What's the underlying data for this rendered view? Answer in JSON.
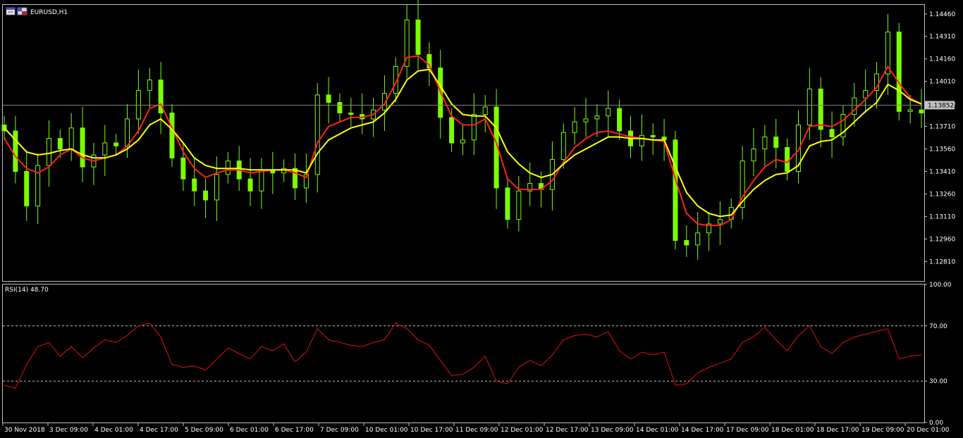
{
  "window": {
    "symbol_title": "EURUSD,H1",
    "icons": [
      "chart-window-icon",
      "symbol-flag-icon"
    ]
  },
  "colors": {
    "background": "#000000",
    "axis": "#c0c0c0",
    "candle": "#7CFC00",
    "ma_fast": "#ff2020",
    "ma_slow": "#ffff00",
    "rsi_line": "#e01010",
    "current_price_box": "#c0c0c0"
  },
  "chart_data": [
    {
      "type": "candlestick",
      "title": "EURUSD,H1",
      "ylim": [
        1.1268,
        1.1452
      ],
      "y_ticks": [
        "1.14460",
        "1.14310",
        "1.14160",
        "1.14010",
        "1.13860",
        "1.13710",
        "1.13560",
        "1.13410",
        "1.13260",
        "1.13110",
        "1.12960",
        "1.12810"
      ],
      "current_price": "1.13852",
      "x_ticks": [
        "30 Nov 2018",
        "3 Dec 09:00",
        "4 Dec 01:00",
        "4 Dec 17:00",
        "5 Dec 09:00",
        "6 Dec 01:00",
        "6 Dec 17:00",
        "7 Dec 09:00",
        "10 Dec 01:00",
        "10 Dec 17:00",
        "11 Dec 09:00",
        "12 Dec 01:00",
        "12 Dec 17:00",
        "13 Dec 09:00",
        "14 Dec 01:00",
        "14 Dec 17:00",
        "17 Dec 09:00",
        "18 Dec 01:00",
        "18 Dec 17:00",
        "19 Dec 09:00",
        "20 Dec 01:00"
      ],
      "series": [
        {
          "kind": "close",
          "values": [
            1.1368,
            1.1341,
            1.1318,
            1.1345,
            1.1363,
            1.1356,
            1.137,
            1.1344,
            1.1352,
            1.136,
            1.1358,
            1.1376,
            1.1395,
            1.1402,
            1.138,
            1.135,
            1.1336,
            1.1328,
            1.1322,
            1.1339,
            1.1348,
            1.1336,
            1.1328,
            1.1342,
            1.134,
            1.1343,
            1.133,
            1.1339,
            1.1392,
            1.1387,
            1.138,
            1.1379,
            1.1376,
            1.1382,
            1.1393,
            1.1411,
            1.1442,
            1.1419,
            1.141,
            1.1377,
            1.136,
            1.1362,
            1.1379,
            1.1384,
            1.133,
            1.1309,
            1.1328,
            1.1333,
            1.1329,
            1.1349,
            1.1367,
            1.1374,
            1.1376,
            1.1378,
            1.1383,
            1.1368,
            1.1358,
            1.1365,
            1.1364,
            1.1362,
            1.1295,
            1.1292,
            1.13,
            1.1306,
            1.1309,
            1.1317,
            1.1348,
            1.1356,
            1.1364,
            1.1357,
            1.1341,
            1.1372,
            1.1396,
            1.1369,
            1.1364,
            1.1379,
            1.139,
            1.1395,
            1.1406,
            1.1434,
            1.1381,
            1.1382,
            1.138
          ]
        },
        {
          "name": "",
          "kind": "ma_fast",
          "values": [
            1.1363,
            1.1351,
            1.1343,
            1.134,
            1.1344,
            1.1352,
            1.1356,
            1.135,
            1.1348,
            1.135,
            1.1352,
            1.1358,
            1.1368,
            1.1383,
            1.1386,
            1.137,
            1.1354,
            1.1343,
            1.1337,
            1.134,
            1.1342,
            1.1342,
            1.134,
            1.1341,
            1.1342,
            1.1342,
            1.134,
            1.1337,
            1.136,
            1.1371,
            1.1374,
            1.1377,
            1.1377,
            1.1379,
            1.1386,
            1.14,
            1.1417,
            1.1418,
            1.1412,
            1.1394,
            1.1378,
            1.1372,
            1.1372,
            1.1376,
            1.136,
            1.1336,
            1.1329,
            1.1329,
            1.1329,
            1.1335,
            1.1347,
            1.1357,
            1.1363,
            1.1367,
            1.1368,
            1.1366,
            1.1364,
            1.1363,
            1.1362,
            1.1361,
            1.1336,
            1.1313,
            1.1306,
            1.1305,
            1.1305,
            1.1309,
            1.1324,
            1.1335,
            1.1344,
            1.1349,
            1.1347,
            1.1355,
            1.1371,
            1.1372,
            1.1371,
            1.1375,
            1.1382,
            1.1389,
            1.1397,
            1.1411,
            1.14,
            1.139,
            1.1386
          ]
        },
        {
          "name": "",
          "kind": "ma_slow",
          "values": [
            1.137,
            1.1362,
            1.1354,
            1.1352,
            1.1353,
            1.1355,
            1.1356,
            1.1352,
            1.135,
            1.135,
            1.1352,
            1.1356,
            1.1362,
            1.1372,
            1.1376,
            1.1369,
            1.136,
            1.135,
            1.1345,
            1.1343,
            1.1343,
            1.1343,
            1.1342,
            1.1342,
            1.1342,
            1.1342,
            1.1342,
            1.134,
            1.1353,
            1.1362,
            1.1366,
            1.137,
            1.1372,
            1.1374,
            1.138,
            1.1389,
            1.1402,
            1.1408,
            1.1409,
            1.1398,
            1.1386,
            1.1379,
            1.1378,
            1.1378,
            1.137,
            1.1354,
            1.1346,
            1.134,
            1.1337,
            1.1339,
            1.1346,
            1.1352,
            1.1356,
            1.136,
            1.1364,
            1.1364,
            1.1363,
            1.1363,
            1.1362,
            1.1362,
            1.1344,
            1.1327,
            1.1318,
            1.1313,
            1.1311,
            1.1312,
            1.1321,
            1.1329,
            1.1335,
            1.1339,
            1.134,
            1.1345,
            1.1358,
            1.1361,
            1.1362,
            1.1367,
            1.1374,
            1.1381,
            1.1387,
            1.1399,
            1.1395,
            1.1389,
            1.1386
          ]
        }
      ]
    },
    {
      "type": "line",
      "title": "RSI(14) 48.70",
      "ylim": [
        0,
        100
      ],
      "y_ticks": [
        "100.00",
        "70.00",
        "30.00",
        "0.00"
      ],
      "levels": [
        70,
        30
      ],
      "series": [
        {
          "name": "RSI(14)",
          "values": [
            27,
            25,
            42,
            55,
            58,
            48,
            55,
            47,
            54,
            60,
            58,
            63,
            70,
            72,
            62,
            42,
            40,
            41,
            38,
            46,
            54,
            50,
            46,
            55,
            52,
            57,
            44,
            51,
            68,
            60,
            58,
            56,
            55,
            58,
            60,
            72,
            68,
            60,
            56,
            45,
            34,
            35,
            40,
            48,
            30,
            28,
            40,
            45,
            41,
            49,
            60,
            63,
            64,
            62,
            66,
            52,
            46,
            51,
            49,
            51,
            27,
            28,
            36,
            40,
            43,
            46,
            58,
            62,
            69,
            60,
            52,
            63,
            70,
            55,
            50,
            58,
            62,
            64,
            66,
            68,
            46,
            48,
            49
          ]
        }
      ]
    }
  ]
}
